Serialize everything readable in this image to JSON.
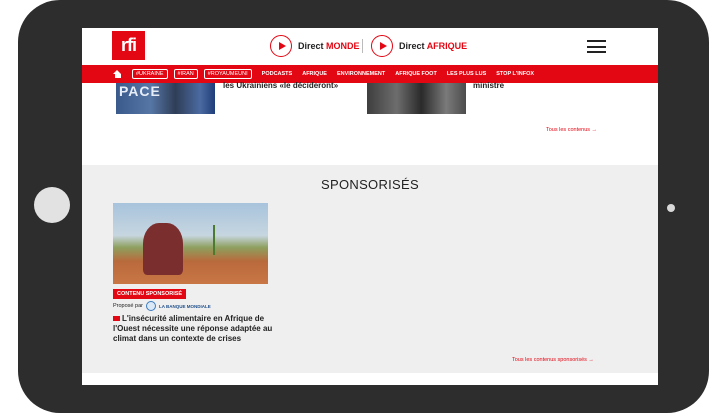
{
  "header": {
    "logo_text": "rfi",
    "live_monde_prefix": "Direct",
    "live_monde_accent": "MONDE",
    "live_afrique_prefix": "Direct",
    "live_afrique_accent": "AFRIQUE"
  },
  "nav": {
    "tags": [
      "#UKRAINE",
      "#IRAN",
      "#ROYAUMEUNI"
    ],
    "links": [
      "PODCASTS",
      "AFRIQUE",
      "ENVIRONNEMENT",
      "AFRIQUE FOOT",
      "LES PLUS LUS",
      "STOP L'INFOX"
    ]
  },
  "articles": {
    "first_title": "les Ukrainiens «le décideront»",
    "first_image_text": "PACE",
    "second_title": "ministre",
    "all_content_link": "Tous les contenus →"
  },
  "sponsored": {
    "section_title": "SPONSORISÉS",
    "badge": "CONTENU SPONSORISÉ",
    "proposed_by": "Proposé par",
    "sponsor_name": "LA BANQUE MONDIALE",
    "headline": "L'insécurité alimentaire en Afrique de l'Ouest nécessite une réponse adaptée au climat dans un contexte de crises",
    "all_link": "Tous les contenus sponsorisés →"
  },
  "colors": {
    "brand_red": "#e30613",
    "sponsored_bg": "#efefef",
    "tablet_frame": "#2d2d2d"
  }
}
